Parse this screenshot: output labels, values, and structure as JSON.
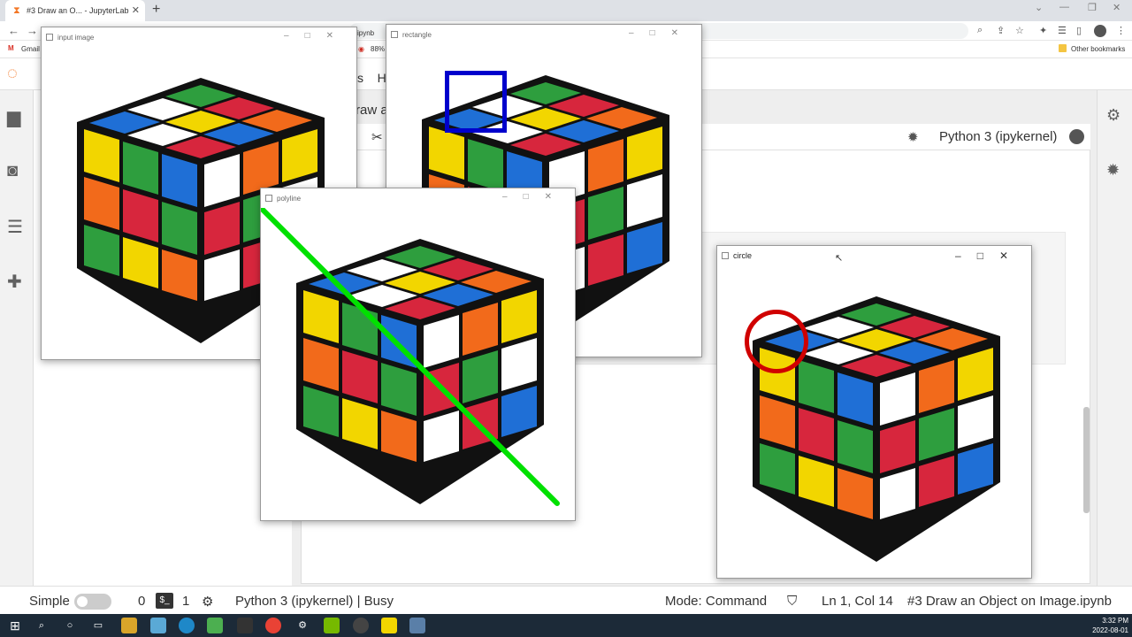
{
  "browser": {
    "tab_title": "#3 Draw an O... - JupyterLab",
    "tab_favicon": "hourglass-icon",
    "bookmarks": [
      {
        "label": "Gmail"
      }
    ],
    "other_bookmarks": "Other bookmarks",
    "peek_filename": "ipynb",
    "peek_zoom": "88%"
  },
  "jupyter": {
    "kernel_name": "Python 3 (ipykernel)",
    "toolbar_peek": "H",
    "cell_peek": "raw a",
    "tab_peek": "s"
  },
  "status_bar": {
    "mode_label": "Simple",
    "count_a": "0",
    "count_b": "1",
    "kernel_status": "Python 3 (ipykernel) | Busy",
    "mode": "Mode: Command",
    "cursor": "Ln 1, Col 14",
    "filename": "#3 Draw an Object on Image.ipynb"
  },
  "windows": {
    "input_image": {
      "title": "input image"
    },
    "rectangle": {
      "title": "rectangle"
    },
    "polyline": {
      "title": "polyline"
    },
    "circle": {
      "title": "circle"
    }
  },
  "taskbar": {
    "time": "3:32 PM",
    "date": "2022-08-01"
  },
  "colors": {
    "cube_red": "#d7263d",
    "cube_blue": "#1f6fd6",
    "cube_green": "#2e9e3e",
    "cube_yellow": "#f2d600",
    "cube_orange": "#f26a1b",
    "cube_white": "#ffffff",
    "rect_blue": "#0000cc",
    "line_green": "#00e000",
    "circle_red": "#d00000"
  }
}
